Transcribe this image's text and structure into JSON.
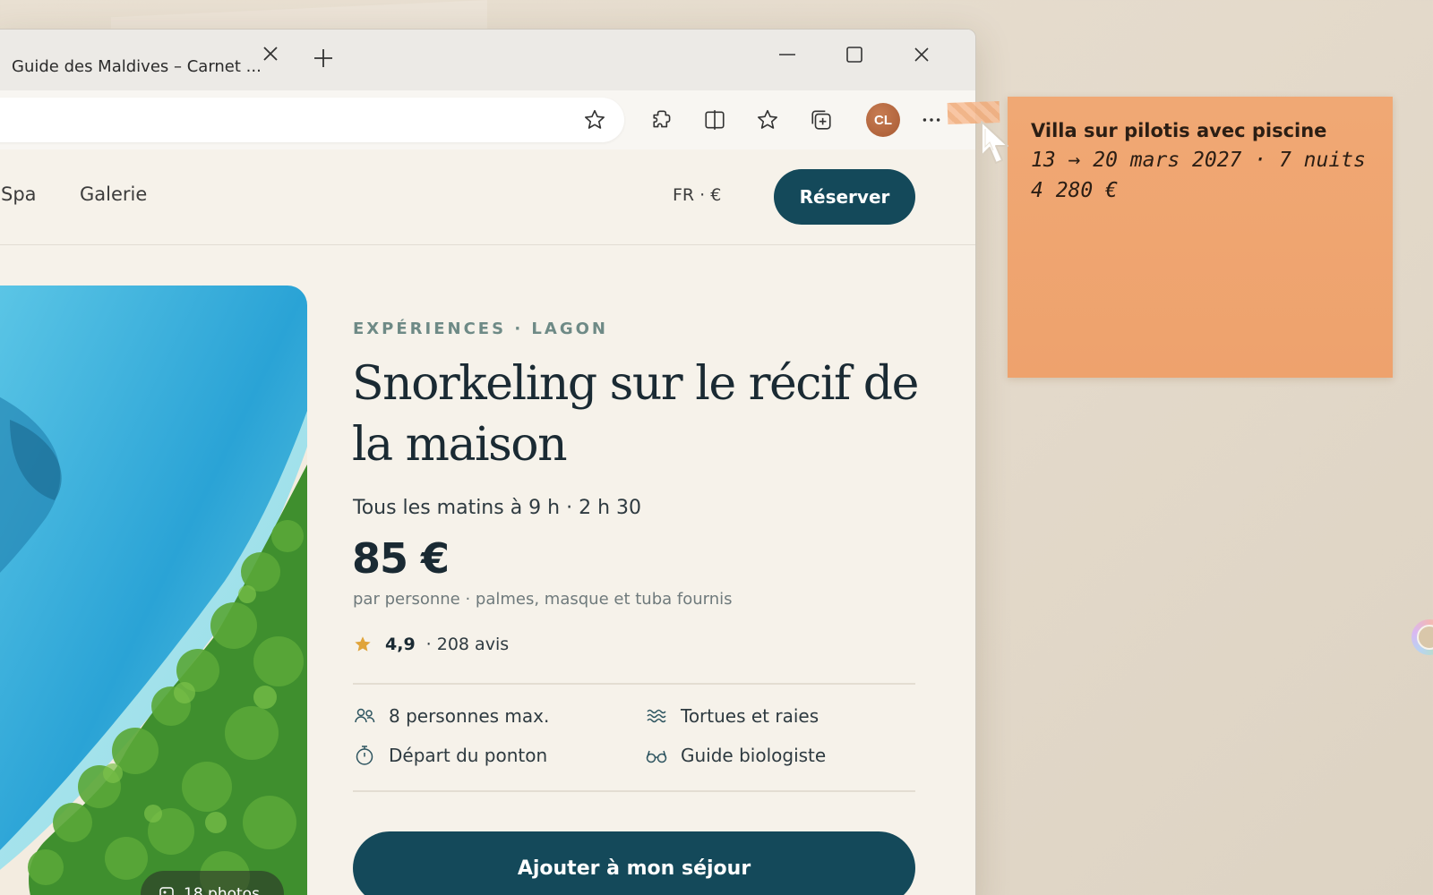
{
  "browser": {
    "tab_title": "Guide des Maldives – Carnet ...",
    "avatar_initials": "CL"
  },
  "site": {
    "nav": {
      "link_spa": "Spa",
      "link_gallery": "Galerie",
      "lang_currency": "FR · €",
      "reserve_label": "Réserver"
    },
    "photo_count_label": "18 photos",
    "eyebrow": "EXPÉRIENCES · LAGON",
    "headline": "Snorkeling sur le récif de la maison",
    "schedule": "Tous les matins à 9 h · 2 h 30",
    "price": "85 €",
    "price_note": "par personne · palmes, masque et tuba fournis",
    "rating": {
      "score": "4,9",
      "reviews": "· 208 avis",
      "star_color": "#e0a43a"
    },
    "features": [
      {
        "icon": "people-icon",
        "label": "8 personnes max."
      },
      {
        "icon": "waves-icon",
        "label": "Tortues et raies"
      },
      {
        "icon": "stopwatch-icon",
        "label": "Départ du ponton"
      },
      {
        "icon": "glasses-icon",
        "label": "Guide biologiste"
      }
    ],
    "add_button_label": "Ajouter à mon séjour",
    "accent_color": "#14495a"
  },
  "sticky_note": {
    "title": "Villa sur pilotis avec piscine",
    "line1": "13 → 20 mars 2027 · 7 nuits",
    "line2": "4 280 €",
    "color": "#f0a874"
  }
}
